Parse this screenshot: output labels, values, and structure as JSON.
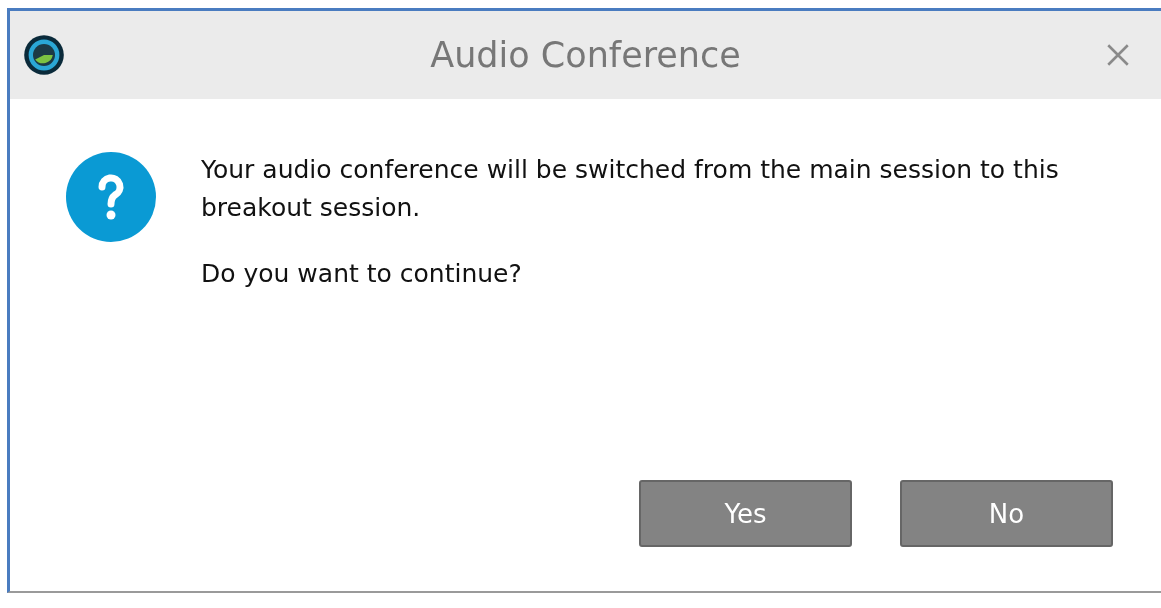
{
  "window": {
    "title": "Audio Conference"
  },
  "message": {
    "lines": [
      "Your audio conference will be switched from the main session to this breakout session.",
      "Do you want to continue?"
    ]
  },
  "buttons": [
    {
      "label": "Yes"
    },
    {
      "label": "No"
    }
  ]
}
